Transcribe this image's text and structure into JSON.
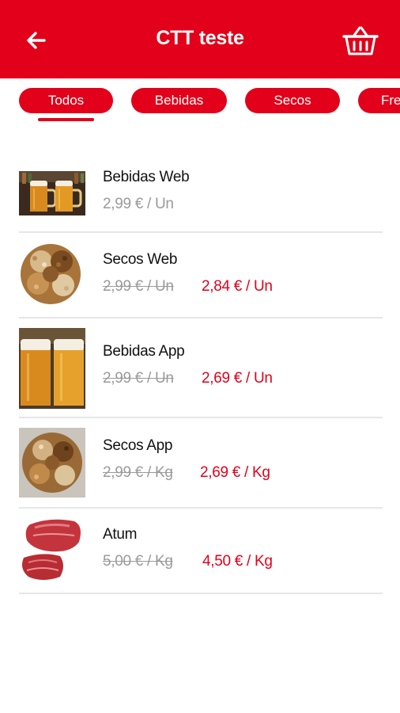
{
  "header": {
    "title": "CTT teste",
    "back_icon": "arrow-left-icon",
    "cart_icon": "shopping-basket-icon",
    "background": "#e2001a"
  },
  "tabs": [
    {
      "label": "Todos",
      "selected": true
    },
    {
      "label": "Bebidas",
      "selected": false
    },
    {
      "label": "Secos",
      "selected": false
    },
    {
      "label": "Fre",
      "selected": false
    }
  ],
  "products": [
    {
      "name": "Bebidas Web",
      "price": "2,99 € / Un",
      "image": "beer-mugs-image"
    },
    {
      "name": "Secos Web",
      "old_price": "2,99 € / Un",
      "new_price": "2,84 € / Un",
      "image": "nuts-image"
    },
    {
      "name": "Bebidas App",
      "old_price": "2,99 € / Un",
      "new_price": "2,69 € / Un",
      "image": "beer-glasses-image"
    },
    {
      "name": "Secos App",
      "old_price": "2,99 € / Kg",
      "new_price": "2,69 € / Kg",
      "image": "nuts-plate-image"
    },
    {
      "name": "Atum",
      "old_price": "5,00 € / Kg",
      "new_price": "4,50 € / Kg",
      "image": "tuna-steak-image"
    }
  ],
  "colors": {
    "accent": "#e2001a",
    "muted_text": "#9a9a9a",
    "divider": "#e6e6e6"
  }
}
